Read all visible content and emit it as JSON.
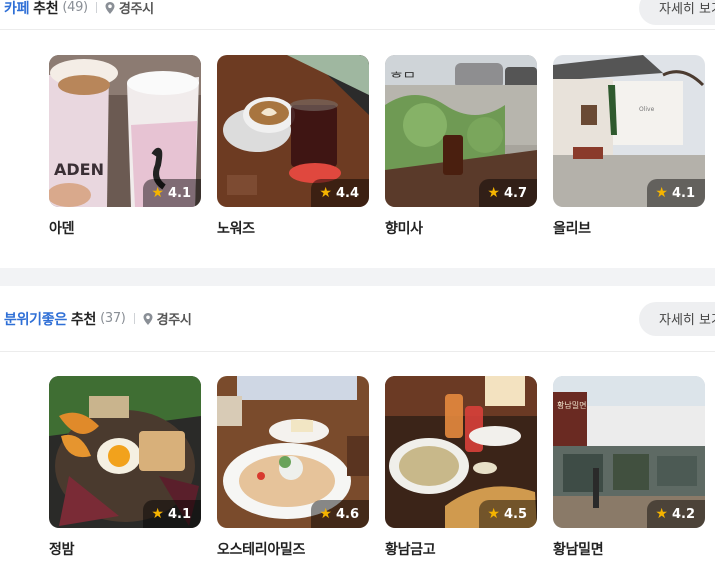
{
  "sections": [
    {
      "keyword": "카페",
      "suffix": "추천",
      "count": "(49)",
      "location": "경주시",
      "more_label": "자세히 보기",
      "items": [
        {
          "name": "아덴",
          "rating": "4.1"
        },
        {
          "name": "노워즈",
          "rating": "4.4"
        },
        {
          "name": "향미사",
          "rating": "4.7"
        },
        {
          "name": "올리브",
          "rating": "4.1"
        }
      ]
    },
    {
      "keyword": "분위기좋은",
      "suffix": "추천",
      "count": "(37)",
      "location": "경주시",
      "more_label": "자세히 보기",
      "items": [
        {
          "name": "정밤",
          "rating": "4.1"
        },
        {
          "name": "오스테리아밀즈",
          "rating": "4.6"
        },
        {
          "name": "황남금고",
          "rating": "4.5"
        },
        {
          "name": "황남밀면",
          "rating": "4.2"
        }
      ]
    }
  ],
  "colors": {
    "keyword": "#2f6fd6",
    "star": "#f5b400"
  }
}
